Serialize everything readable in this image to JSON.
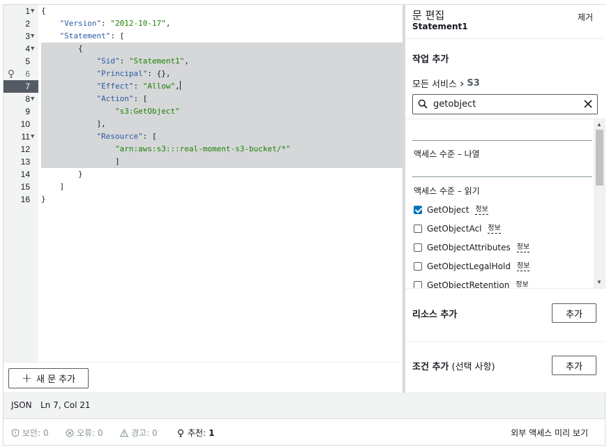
{
  "editor": {
    "lines": [
      {
        "n": "1",
        "fold": true
      },
      {
        "n": "2",
        "fold": false
      },
      {
        "n": "3",
        "fold": true
      },
      {
        "n": "4",
        "fold": true
      },
      {
        "n": "5",
        "fold": false
      },
      {
        "n": "6",
        "fold": false
      },
      {
        "n": "7",
        "fold": false
      },
      {
        "n": "8",
        "fold": true
      },
      {
        "n": "9",
        "fold": false
      },
      {
        "n": "10",
        "fold": false
      },
      {
        "n": "11",
        "fold": true
      },
      {
        "n": "12",
        "fold": false
      },
      {
        "n": "13",
        "fold": false
      },
      {
        "n": "14",
        "fold": false
      },
      {
        "n": "15",
        "fold": false
      },
      {
        "n": "16",
        "fold": false
      }
    ],
    "code": {
      "l1": "{",
      "l2_key": "\"Version\"",
      "l2_val": "\"2012-10-17\"",
      "l3_key": "\"Statement\"",
      "l3_rest": ": [",
      "l4": "{",
      "l5_key": "\"Sid\"",
      "l5_val": "\"Statement1\"",
      "l6_key": "\"Principal\"",
      "l6_rest": ": {},",
      "l7_key": "\"Effect\"",
      "l7_val": "\"Allow\"",
      "l8_key": "\"Action\"",
      "l8_rest": ": [",
      "l9_val": "\"s3:GetObject\"",
      "l10": "],",
      "l11_key": "\"Resource\"",
      "l11_rest": ": [",
      "l12_val": "\"arn:aws:s3:::real-moment-s3-bucket/*\"",
      "l13": "]",
      "l14": "}",
      "l15": "]",
      "l16": "}"
    },
    "add_statement_label": "새 문 추가"
  },
  "panel": {
    "title": "문 편집",
    "subtitle": "Statement1",
    "remove_label": "제거",
    "add_action_title": "작업 추가",
    "breadcrumb_root": "모든 서비스",
    "breadcrumb_current": "S3",
    "search_value": "getobject",
    "group_list": "액세스 수준 – 나열",
    "group_read": "액세스 수준 – 읽기",
    "items": [
      {
        "label": "GetObject",
        "info": "정보",
        "checked": true
      },
      {
        "label": "GetObjectAcl",
        "info": "정보",
        "checked": false
      },
      {
        "label": "GetObjectAttributes",
        "info": "정보",
        "checked": false
      },
      {
        "label": "GetObjectLegalHold",
        "info": "정보",
        "checked": false
      },
      {
        "label": "GetObjectRetention",
        "info": "정보",
        "checked": false
      }
    ],
    "add_resource_label": "리소스 추가",
    "add_resource_button": "추가",
    "add_condition_label": "조건 추가",
    "add_condition_optional": "(선택 사항)",
    "add_condition_button": "추가"
  },
  "status": {
    "mode": "JSON",
    "position": "Ln 7, Col 21"
  },
  "checks": {
    "security": "보안: 0",
    "errors": "오류: 0",
    "warnings": "경고: 0",
    "suggestions_label": "추천:",
    "suggestions_count": "1",
    "preview_link": "외부 액세스 미리 보기"
  }
}
